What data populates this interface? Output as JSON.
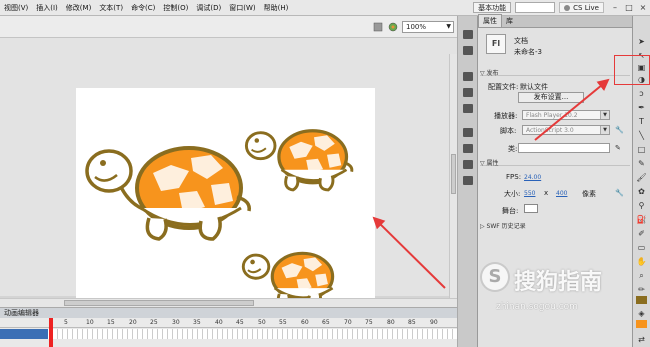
{
  "menu": {
    "items": [
      "视图(V)",
      "插入(I)",
      "修改(M)",
      "文本(T)",
      "命令(C)",
      "控制(O)",
      "调试(D)",
      "窗口(W)",
      "帮助(H)"
    ],
    "workspace": "基本功能",
    "cs_live": "CS Live"
  },
  "stage_toolbar": {
    "zoom": "100%"
  },
  "timeline": {
    "title": "动画编辑器",
    "frame_numbers": [
      "1",
      "5",
      "10",
      "15",
      "20",
      "25",
      "30",
      "35",
      "40",
      "45",
      "50",
      "55",
      "60",
      "65",
      "70",
      "75",
      "80",
      "85",
      "90"
    ]
  },
  "panel": {
    "tabs": [
      "属性",
      "库"
    ],
    "doc_icon": "Fl",
    "doc_type": "文档",
    "doc_name": "未命名-3",
    "publish_section": "发布",
    "profile_label": "配置文件:",
    "profile_value": "默认文件",
    "publish_settings_button": "发布设置...",
    "player_label": "播放器:",
    "player_value": "Flash Player 10.2",
    "script_label": "脚本:",
    "script_value": "ActionScript 3.0",
    "class_label": "类:",
    "properties_section": "属性",
    "fps_label": "FPS:",
    "fps_value": "24.00",
    "size_label": "大小:",
    "width_value": "550",
    "size_x": "x",
    "height_value": "400",
    "size_unit": "像素",
    "stage_label": "舞台:",
    "swf_history": "SWF 历史记录"
  },
  "watermark": {
    "brand": "搜狗指南",
    "url": "zhinan.sogou.com",
    "logo_glyph": "S"
  },
  "colors": {
    "turtle_shell": "#f7941d",
    "turtle_outline": "#8a6d1f",
    "annotation": "#e53a3a",
    "selection_layer": "#3b6fb5"
  }
}
